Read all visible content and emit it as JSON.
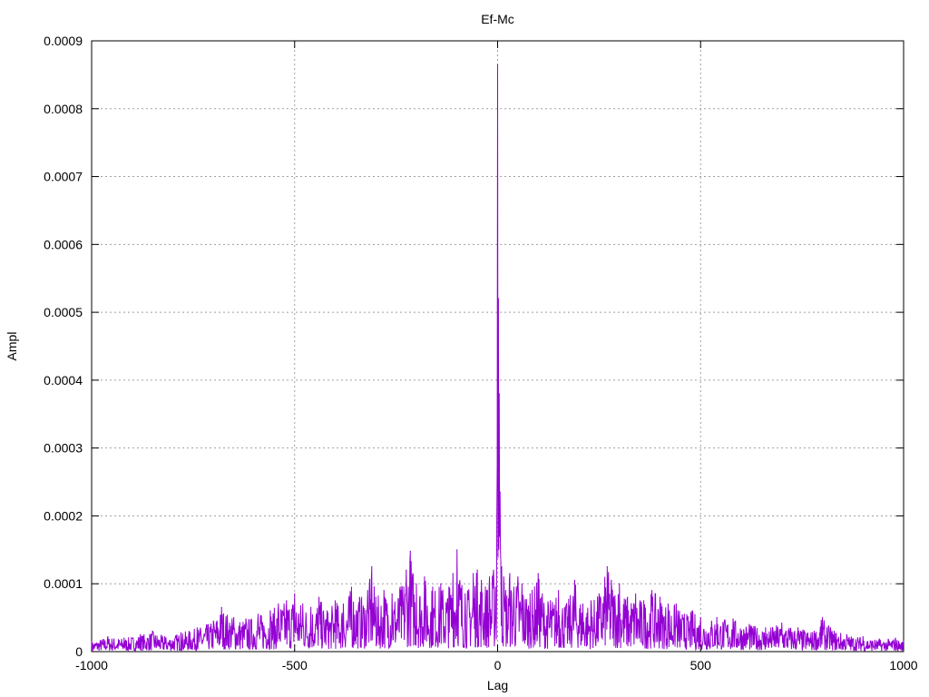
{
  "chart_data": {
    "type": "line",
    "title": "Ef-Mc",
    "xlabel": "Lag",
    "ylabel": "Ampl",
    "xlim": [
      -1000,
      1000
    ],
    "ylim": [
      0,
      0.0009
    ],
    "x_ticks": [
      -1000,
      -500,
      0,
      500,
      1000
    ],
    "y_ticks": [
      0,
      0.0001,
      0.0002,
      0.0003,
      0.0004,
      0.0005,
      0.0006,
      0.0007,
      0.0008,
      0.0009
    ],
    "x_tick_labels": [
      "-1000",
      "-500",
      "0",
      "500",
      "1000"
    ],
    "y_tick_labels": [
      "0",
      "0.0001",
      "0.0002",
      "0.0003",
      "0.0004",
      "0.0005",
      "0.0006",
      "0.0007",
      "0.0008",
      "0.0009"
    ],
    "grid": true,
    "series": [
      {
        "color": "#9400d3",
        "x": [
          -1000,
          -960,
          -920,
          -880,
          -850,
          -820,
          -780,
          -740,
          -700,
          -680,
          -650,
          -620,
          -590,
          -560,
          -540,
          -520,
          -500,
          -480,
          -460,
          -440,
          -420,
          -400,
          -380,
          -360,
          -340,
          -320,
          -310,
          -300,
          -280,
          -260,
          -240,
          -225,
          -215,
          -200,
          -180,
          -160,
          -140,
          -120,
          -110,
          -100,
          -80,
          -60,
          -50,
          -40,
          -30,
          -20,
          -10,
          -5,
          -2,
          0,
          2,
          4,
          6,
          8,
          10,
          15,
          20,
          30,
          40,
          50,
          60,
          80,
          100,
          110,
          130,
          150,
          170,
          190,
          210,
          230,
          250,
          270,
          280,
          300,
          320,
          340,
          360,
          380,
          400,
          420,
          440,
          460,
          480,
          500,
          540,
          580,
          620,
          660,
          700,
          740,
          780,
          800,
          820,
          860,
          900,
          940,
          980,
          1000
        ],
        "y": [
          1.5e-05,
          2.2e-05,
          2e-05,
          2.5e-05,
          3e-05,
          2.2e-05,
          2.8e-05,
          3.5e-05,
          4.5e-05,
          6.5e-05,
          5e-05,
          4.8e-05,
          5.5e-05,
          6e-05,
          7e-05,
          7.5e-05,
          8.5e-05,
          7e-05,
          6.5e-05,
          8e-05,
          6e-05,
          7.5e-05,
          7e-05,
          9.5e-05,
          8e-05,
          9e-05,
          0.000125,
          8e-05,
          9e-05,
          8.5e-05,
          9.5e-05,
          0.00012,
          0.000148,
          0.0001,
          0.00011,
          9.5e-05,
          0.0001,
          9.5e-05,
          0.000115,
          0.00015,
          8.5e-05,
          0.000115,
          0.00012,
          0.000105,
          9.5e-05,
          0.00011,
          0.00012,
          9.5e-05,
          0.00019,
          0.000865,
          0.00052,
          0.00038,
          0.000235,
          0.00013,
          0.000125,
          0.00011,
          9e-05,
          0.000115,
          9.5e-05,
          0.00011,
          0.0001,
          8.5e-05,
          0.000115,
          8.5e-05,
          7.5e-05,
          9e-05,
          7e-05,
          0.000105,
          7e-05,
          7.5e-05,
          8.5e-05,
          0.000125,
          0.000105,
          0.0001,
          8e-05,
          8.5e-05,
          7.5e-05,
          9e-05,
          8e-05,
          7e-05,
          7e-05,
          5.5e-05,
          6e-05,
          5e-05,
          5e-05,
          4.8e-05,
          4e-05,
          3.5e-05,
          4.2e-05,
          3.5e-05,
          3e-05,
          5e-05,
          3.5e-05,
          2.5e-05,
          2.2e-05,
          1.8e-05,
          2e-05,
          1.5e-05
        ]
      }
    ]
  }
}
